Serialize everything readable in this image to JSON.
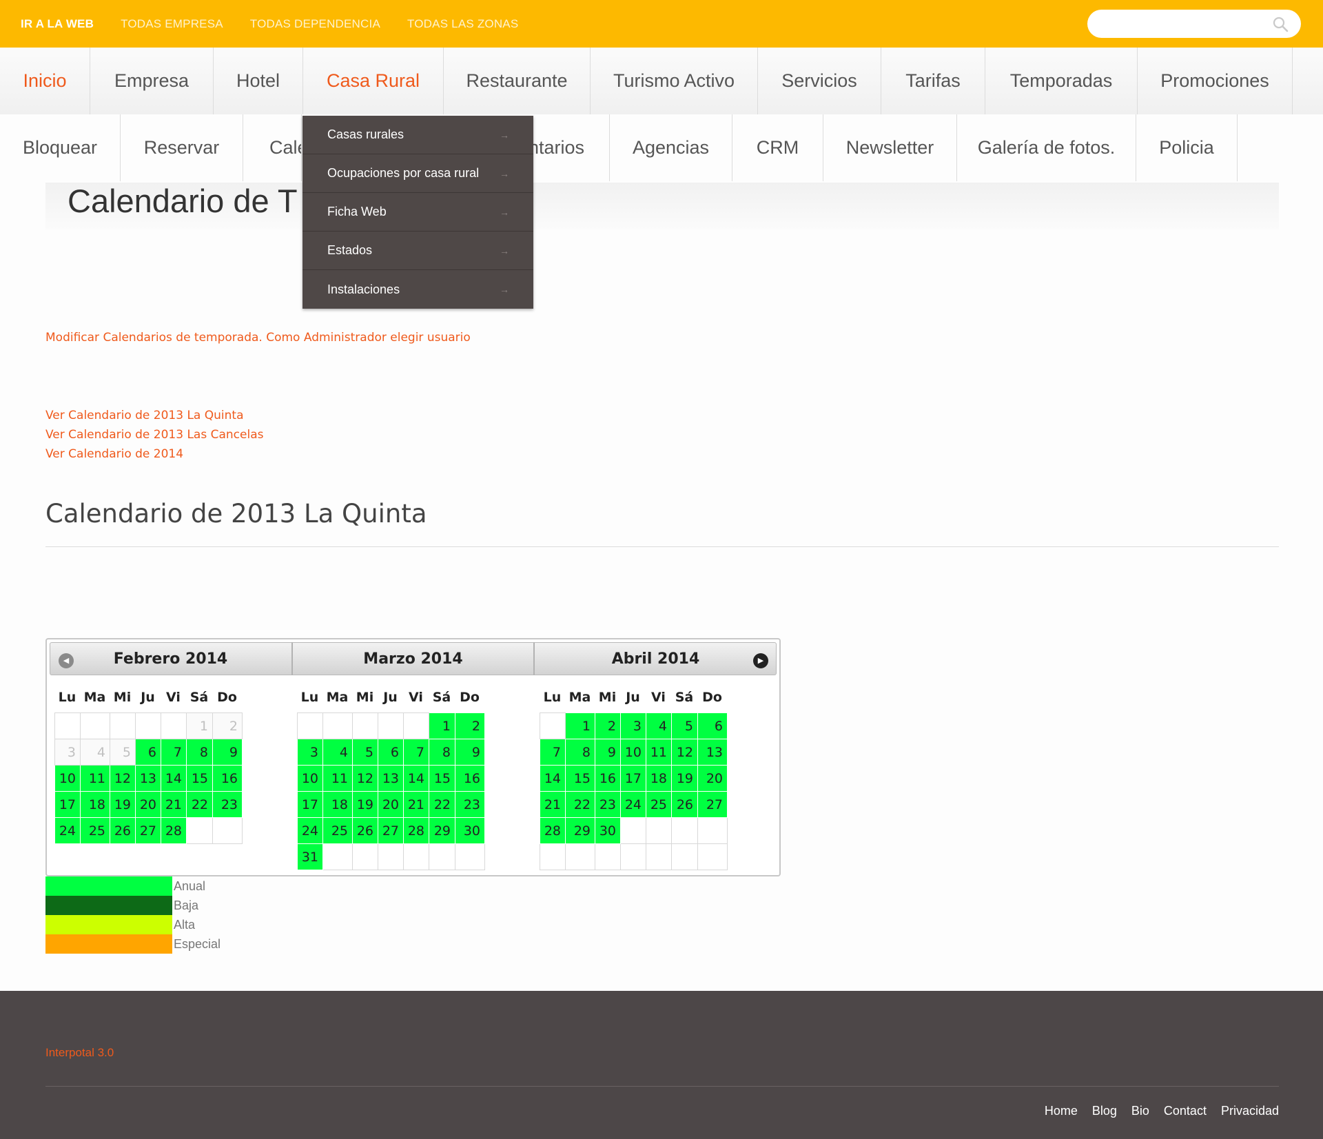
{
  "topbar": {
    "links": [
      "IR A LA WEB",
      "TODAS EMPRESA",
      "TODAS DEPENDENCIA",
      "TODAS LAS ZONAS"
    ],
    "search_placeholder": ""
  },
  "nav_primary": [
    "Inicio",
    "Empresa",
    "Hotel",
    "Casa Rural",
    "Restaurante",
    "Turismo Activo",
    "Servicios",
    "Tarifas",
    "Temporadas",
    "Promociones"
  ],
  "nav_secondary": [
    "Bloquear",
    "Reservar",
    "Cale",
    "ntarios",
    "Agencias",
    "CRM",
    "Newsletter",
    "Galería de fotos.",
    "Policia"
  ],
  "dropdown": [
    "Casas rurales",
    "Ocupaciones por casa rural",
    "Ficha Web",
    "Estados",
    "Instalaciones"
  ],
  "page_title": "Calendario de T",
  "admin_link": "Modificar Calendarios de temporada. Como Administrador elegir usuario",
  "calendar_links": [
    "Ver Calendario de 2013 La Quinta",
    "Ver Calendario de 2013 Las Cancelas",
    "Ver Calendario de 2014"
  ],
  "section_title": "Calendario de 2013 La Quinta",
  "calendar": {
    "weekdays": [
      "Lu",
      "Ma",
      "Mi",
      "Ju",
      "Vi",
      "Sá",
      "Do"
    ],
    "months": [
      {
        "title": "Febrero 2014",
        "weeks": [
          [
            [
              "",
              ""
            ],
            [
              "",
              ""
            ],
            [
              "",
              ""
            ],
            [
              "",
              ""
            ],
            [
              "",
              ""
            ],
            [
              "1",
              "o"
            ],
            [
              "2",
              "o"
            ]
          ],
          [
            [
              "3",
              "o"
            ],
            [
              "4",
              "o"
            ],
            [
              "5",
              "o"
            ],
            [
              "6",
              "g"
            ],
            [
              "7",
              "g"
            ],
            [
              "8",
              "g"
            ],
            [
              "9",
              "g"
            ]
          ],
          [
            [
              "10",
              "g"
            ],
            [
              "11",
              "g"
            ],
            [
              "12",
              "g"
            ],
            [
              "13",
              "g"
            ],
            [
              "14",
              "g"
            ],
            [
              "15",
              "g"
            ],
            [
              "16",
              "g"
            ]
          ],
          [
            [
              "17",
              "g"
            ],
            [
              "18",
              "g"
            ],
            [
              "19",
              "g"
            ],
            [
              "20",
              "g"
            ],
            [
              "21",
              "g"
            ],
            [
              "22",
              "g"
            ],
            [
              "23",
              "g"
            ]
          ],
          [
            [
              "24",
              "g"
            ],
            [
              "25",
              "g"
            ],
            [
              "26",
              "g"
            ],
            [
              "27",
              "g"
            ],
            [
              "28",
              "g"
            ],
            [
              "",
              ""
            ],
            [
              "",
              ""
            ]
          ]
        ]
      },
      {
        "title": "Marzo 2014",
        "weeks": [
          [
            [
              "",
              ""
            ],
            [
              "",
              ""
            ],
            [
              "",
              ""
            ],
            [
              "",
              ""
            ],
            [
              "",
              ""
            ],
            [
              "1",
              "g"
            ],
            [
              "2",
              "g"
            ]
          ],
          [
            [
              "3",
              "g"
            ],
            [
              "4",
              "g"
            ],
            [
              "5",
              "g"
            ],
            [
              "6",
              "g"
            ],
            [
              "7",
              "g"
            ],
            [
              "8",
              "g"
            ],
            [
              "9",
              "g"
            ]
          ],
          [
            [
              "10",
              "g"
            ],
            [
              "11",
              "g"
            ],
            [
              "12",
              "g"
            ],
            [
              "13",
              "g"
            ],
            [
              "14",
              "g"
            ],
            [
              "15",
              "g"
            ],
            [
              "16",
              "g"
            ]
          ],
          [
            [
              "17",
              "g"
            ],
            [
              "18",
              "g"
            ],
            [
              "19",
              "g"
            ],
            [
              "20",
              "g"
            ],
            [
              "21",
              "g"
            ],
            [
              "22",
              "g"
            ],
            [
              "23",
              "g"
            ]
          ],
          [
            [
              "24",
              "g"
            ],
            [
              "25",
              "g"
            ],
            [
              "26",
              "g"
            ],
            [
              "27",
              "g"
            ],
            [
              "28",
              "g"
            ],
            [
              "29",
              "g"
            ],
            [
              "30",
              "g"
            ]
          ],
          [
            [
              "31",
              "g"
            ],
            [
              "",
              ""
            ],
            [
              "",
              ""
            ],
            [
              "",
              ""
            ],
            [
              "",
              ""
            ],
            [
              "",
              ""
            ],
            [
              "",
              ""
            ]
          ]
        ]
      },
      {
        "title": "Abril 2014",
        "weeks": [
          [
            [
              "",
              ""
            ],
            [
              "1",
              "g"
            ],
            [
              "2",
              "g"
            ],
            [
              "3",
              "g"
            ],
            [
              "4",
              "g"
            ],
            [
              "5",
              "g"
            ],
            [
              "6",
              "g"
            ]
          ],
          [
            [
              "7",
              "g"
            ],
            [
              "8",
              "g"
            ],
            [
              "9",
              "g"
            ],
            [
              "10",
              "g"
            ],
            [
              "11",
              "g"
            ],
            [
              "12",
              "g"
            ],
            [
              "13",
              "g"
            ]
          ],
          [
            [
              "14",
              "g"
            ],
            [
              "15",
              "g"
            ],
            [
              "16",
              "g"
            ],
            [
              "17",
              "g"
            ],
            [
              "18",
              "g"
            ],
            [
              "19",
              "g"
            ],
            [
              "20",
              "g"
            ]
          ],
          [
            [
              "21",
              "g"
            ],
            [
              "22",
              "g"
            ],
            [
              "23",
              "g"
            ],
            [
              "24",
              "g"
            ],
            [
              "25",
              "g"
            ],
            [
              "26",
              "g"
            ],
            [
              "27",
              "g"
            ]
          ],
          [
            [
              "28",
              "g"
            ],
            [
              "29",
              "g"
            ],
            [
              "30",
              "g"
            ],
            [
              "",
              ""
            ],
            [
              "",
              ""
            ],
            [
              "",
              ""
            ],
            [
              "",
              ""
            ]
          ],
          [
            [
              "",
              ""
            ],
            [
              "",
              ""
            ],
            [
              "",
              ""
            ],
            [
              "",
              ""
            ],
            [
              "",
              ""
            ],
            [
              "",
              ""
            ],
            [
              "",
              ""
            ]
          ]
        ]
      }
    ]
  },
  "legend": [
    {
      "label": "Anual",
      "color": "#00ff41"
    },
    {
      "label": "Baja",
      "color": "#0d6a17"
    },
    {
      "label": "Alta",
      "color": "#ccff00"
    },
    {
      "label": "Especial",
      "color": "#ffa500"
    }
  ],
  "footer": {
    "brand": "Interpotal 3.0",
    "links": [
      "Home",
      "Blog",
      "Bio",
      "Contact",
      "Privacidad"
    ]
  },
  "colors": {
    "accent": "#ef5a1c",
    "topbar": "#fdb900",
    "footer": "#4d4748",
    "day_green": "#00ff41"
  }
}
